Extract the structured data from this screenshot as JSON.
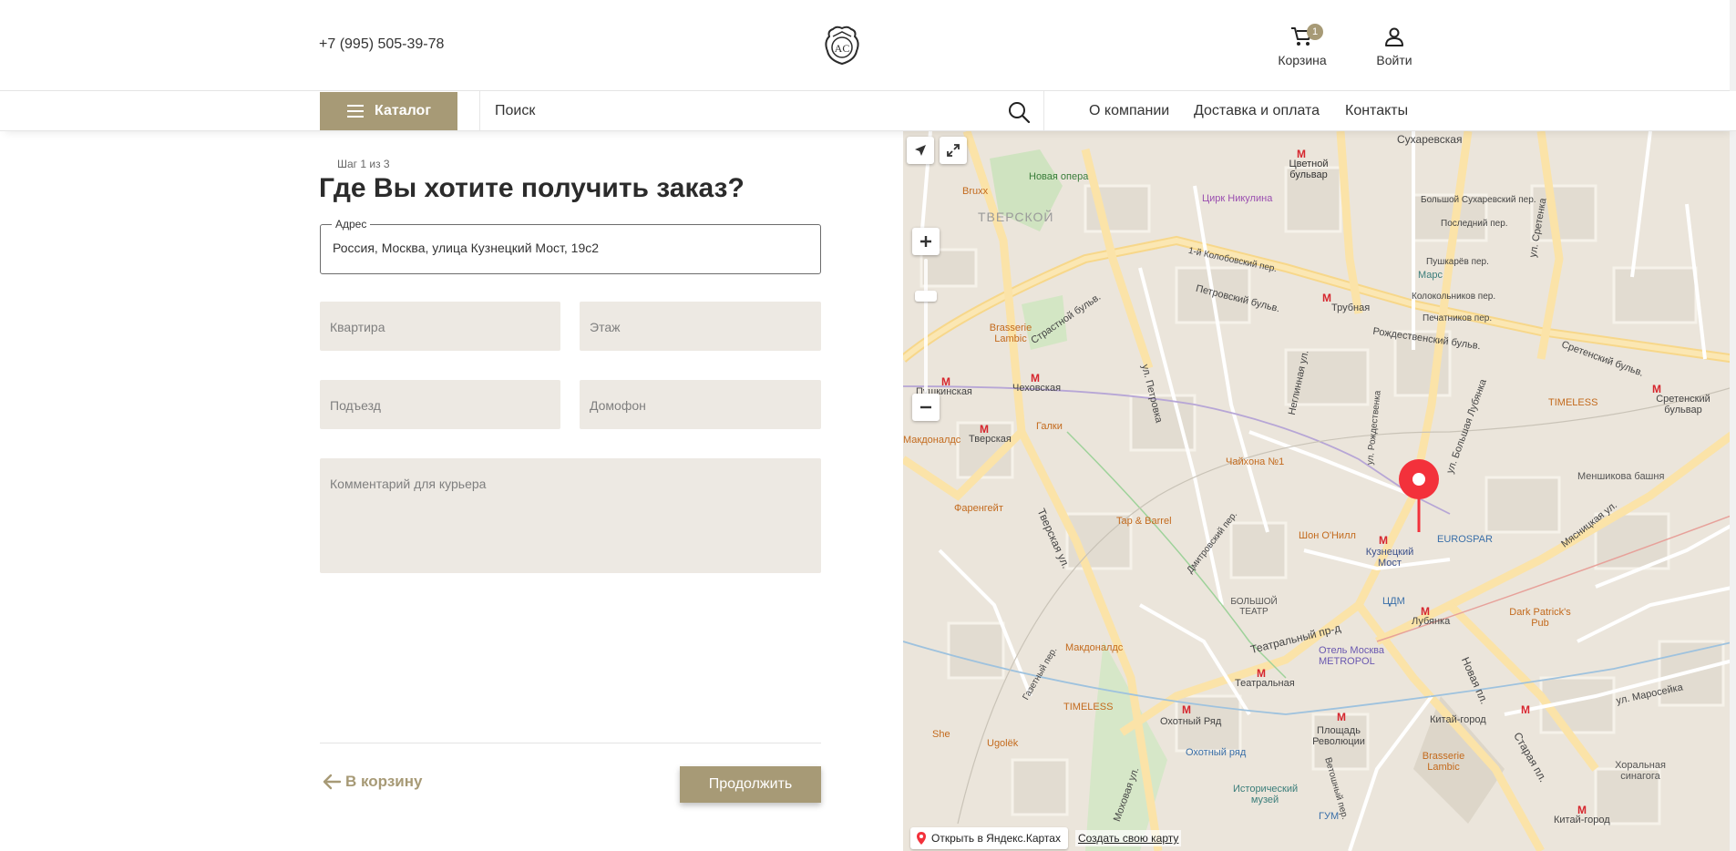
{
  "header": {
    "phone": "+7 (995) 505-39-78",
    "logo_text": "AC",
    "cart_label": "Корзина",
    "cart_count": "1",
    "login_label": "Войти"
  },
  "nav": {
    "catalog_label": "Каталог",
    "search_placeholder": "Поиск",
    "links": [
      "О компании",
      "Доставка и оплата",
      "Контакты"
    ]
  },
  "form": {
    "step": "Шаг 1 из 3",
    "title": "Где Вы хотите получить заказ?",
    "address_label": "Адрес",
    "address_value": "Россия, Москва, улица Кузнецкий Мост, 19с2",
    "apartment_placeholder": "Квартира",
    "floor_placeholder": "Этаж",
    "entrance_placeholder": "Подъезд",
    "intercom_placeholder": "Домофон",
    "comment_placeholder": "Комментарий для курьера",
    "back_label": "В корзину",
    "continue_label": "Продолжить"
  },
  "map": {
    "open_label": "Открыть в Яндекс.Картах",
    "create_label": "Создать свою карту",
    "labels": {
      "sukharevskaya": "Сухаревская",
      "tsvetnoy": "Цветной бульвар",
      "novaya_opera": "Новая опера",
      "bruxx": "Bruxx",
      "tverskoy": "ТВЕРСКОЙ",
      "tsirk": "Цирк Никулина",
      "mars": "Марс",
      "trubnaya": "Трубная",
      "petrovsky_bulv": "Петровский бульв.",
      "rozhdestvensky": "Рождественский бульв.",
      "sretensky": "Сретенский бульв.",
      "brasserie_lambic": "Brasserie Lambic",
      "pushkinskaya": "Пушкинская",
      "chekhovskaya": "Чеховская",
      "tverskaya": "Тверская",
      "makdonalds": "Макдоналдс",
      "galki": "Галки",
      "timeless": "TIMELESS",
      "sretensky_metro": "Сретенский бульвар",
      "chaykhona": "Чайхона №1",
      "farengeyt": "Фаренгейт",
      "tap_barrel": "Tap & Barrel",
      "shon": "Шон О'Нилл",
      "kuznetsky": "Кузнецкий Мост",
      "eurospar": "EUROSPAR",
      "menshikova": "Меншикова башня",
      "bolshoy": "БОЛЬШОЙ ТЕАТР",
      "tsdm": "ЦДМ",
      "lubyanka": "Лубянка",
      "dark_patrick": "Dark Patrick's Pub",
      "teatralny": "Театральный пр-д",
      "metropol": "Отель Москва METROPOL",
      "teatralnaya": "Театральная",
      "makdonalds2": "Макдоналдс",
      "timeless2": "TIMELESS",
      "okhotny": "Охотный Ряд",
      "okhotny_tc": "Охотный ряд",
      "ploshchad": "Площадь Революции",
      "kitay": "Китай-город",
      "she": "She",
      "ugolek": "Ugolёk",
      "istorichesky": "Исторический музей",
      "gum": "ГУМ",
      "brasserie2": "Brasserie Lambic",
      "khoralnaya": "Хоральная синагога",
      "kitay2": "Китай-город",
      "myasnitskaya": "Мясницкая ул.",
      "tverskaya_ul": "Тверская ул.",
      "novaya_pl": "Новая пл.",
      "staraya_pl": "Старая пл.",
      "neglinnaya": "Неглинная ул.",
      "petrovka": "ул. Петровка",
      "bolshaya_lubyanka": "ул. Большая Лубянка",
      "strastnoy": "Страстной бульв.",
      "maroseyka": "ул. Маросейка",
      "pechatnikov": "Печатников пер.",
      "kolokolnikov": "Колокольников пер.",
      "pushkarev": "Пушкарёв пер.",
      "posledny": "Последний пер.",
      "b_sukharevsky": "Большой Сухаревский пер.",
      "kolobovsky": "1-й Колобовский пер.",
      "sretenka": "ул. Сретенка",
      "rozhdestvenka": "ул. Рождественка",
      "dmitrovsky": "Дмитровский пер.",
      "gazetny": "Газетный пер.",
      "mokhovaya": "Моховая ул.",
      "vetoshny": "Ветошный пер."
    }
  }
}
